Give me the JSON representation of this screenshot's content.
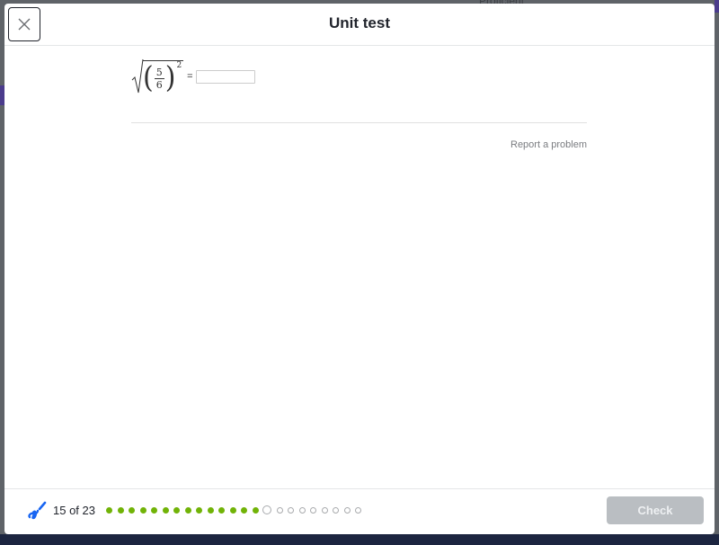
{
  "backdrop": {
    "peek_text": "Proficient"
  },
  "header": {
    "title": "Unit test",
    "close_icon": "close-icon"
  },
  "problem": {
    "expression": "sqrt((5/6)^2)",
    "numerator": "5",
    "denominator": "6",
    "exponent": "2",
    "equals": "=",
    "answer_value": "",
    "answer_placeholder": ""
  },
  "report_link": "Report a problem",
  "footer": {
    "logo_icon": "khan-scribble-icon",
    "progress_text": "15 of 23",
    "progress": {
      "current": 15,
      "total": 23,
      "completed": 14
    },
    "colors": {
      "done": "#71b307",
      "todo_border": "#a8aaad"
    },
    "check_label": "Check",
    "check_disabled": true
  }
}
